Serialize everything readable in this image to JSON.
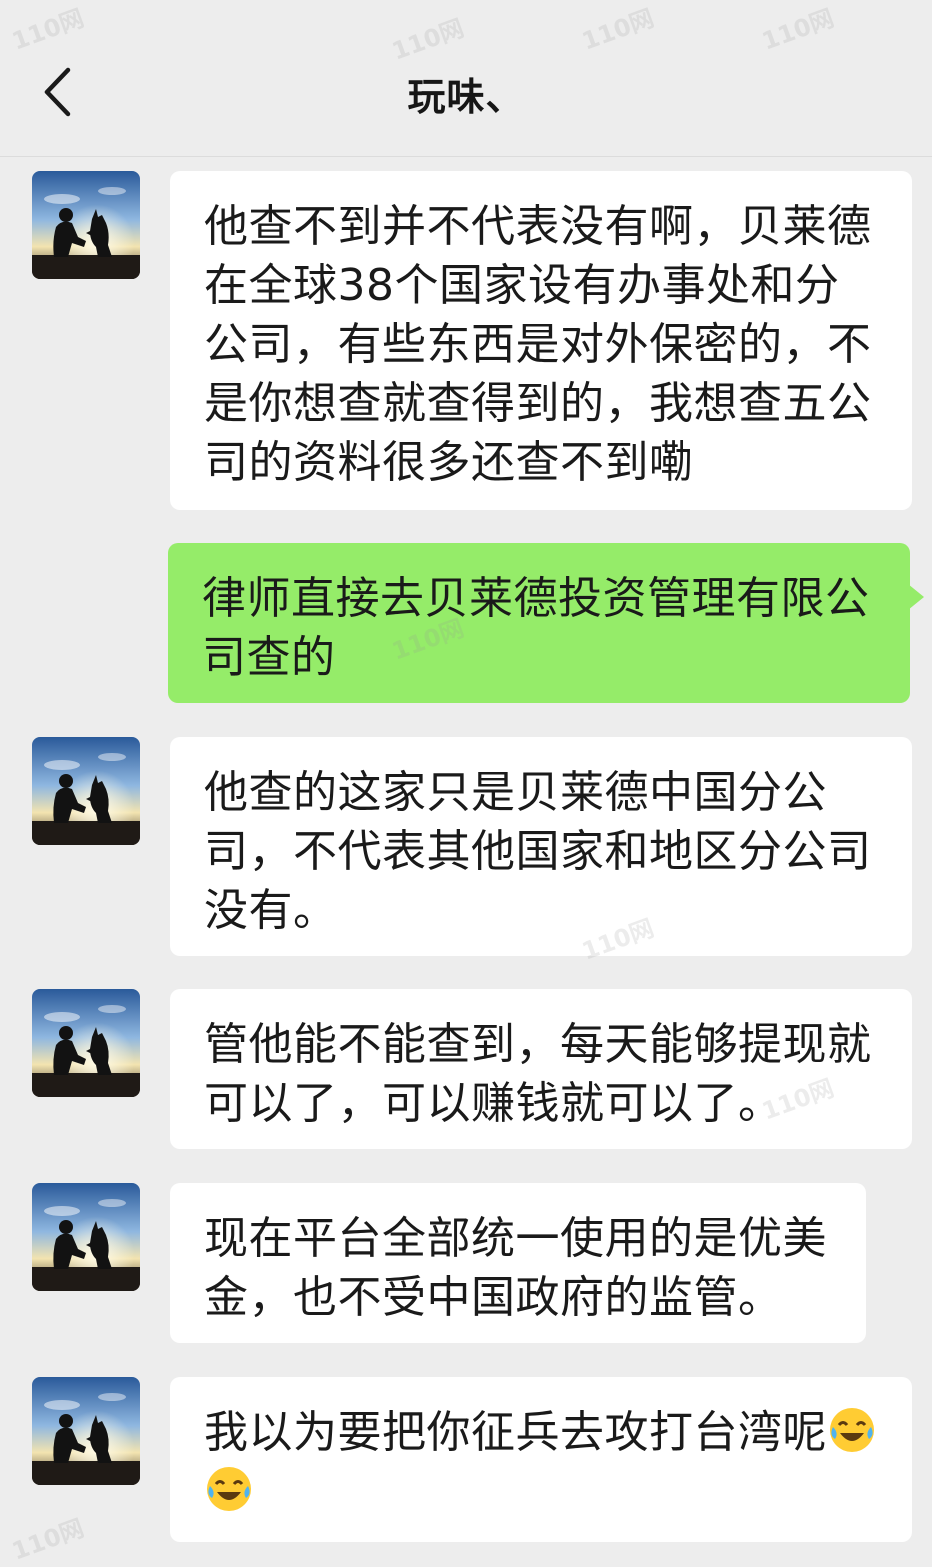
{
  "header": {
    "title": "玩味、",
    "back_icon": "chevron-left-icon"
  },
  "watermark": "110网",
  "messages": [
    {
      "sender": "other",
      "avatar": "silhouette-avatar",
      "text": "他查不到并不代表没有啊，贝莱德在全球38个国家设有办事处和分公司，有些东西是对外保密的，不是你想查就查得到的，我想查五公司的资料很多还查不到嘞"
    },
    {
      "sender": "self",
      "text": "律师直接去贝莱德投资管理有限公司查的"
    },
    {
      "sender": "other",
      "avatar": "silhouette-avatar",
      "text": "他查的这家只是贝莱德中国分公司，不代表其他国家和地区分公司没有。"
    },
    {
      "sender": "other",
      "avatar": "silhouette-avatar",
      "text": "管他能不能查到，每天能够提现就可以了，可以赚钱就可以了。"
    },
    {
      "sender": "other",
      "avatar": "silhouette-avatar",
      "text": "现在平台全部统一使用的是优美金，也不受中国政府的监管。"
    },
    {
      "sender": "other",
      "avatar": "silhouette-avatar",
      "text": "我以为要把你征兵去攻打台湾呢",
      "emojis": [
        "laughing-crying-emoji",
        "laughing-crying-emoji"
      ]
    }
  ]
}
